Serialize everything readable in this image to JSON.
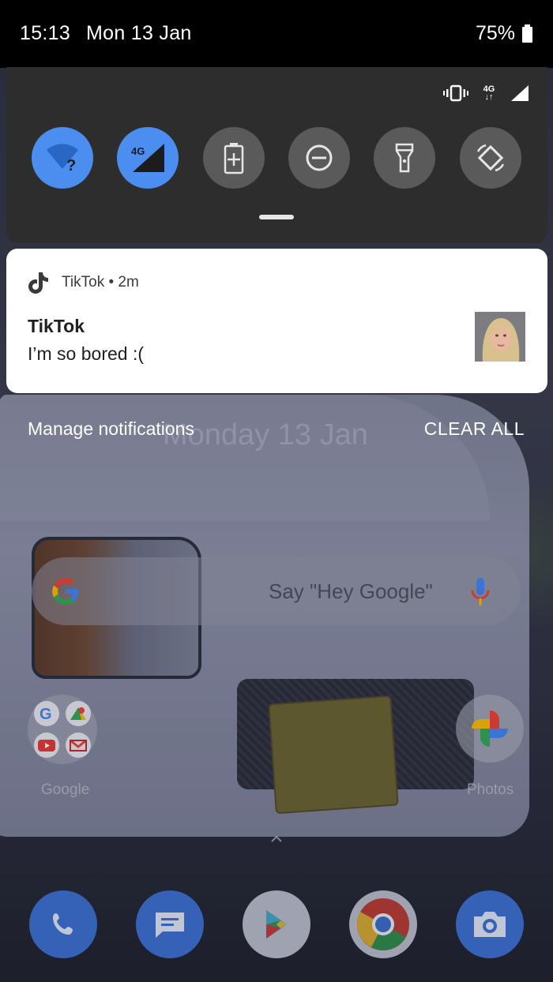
{
  "status_bar": {
    "time": "15:13",
    "date": "Mon 13 Jan",
    "battery": "75%"
  },
  "quick_settings": {
    "network_label": "4G",
    "tiles": [
      {
        "icon": "wifi-unknown-icon",
        "active": true
      },
      {
        "icon": "mobile-data-4g-icon",
        "active": true,
        "label": "4G"
      },
      {
        "icon": "battery-saver-icon",
        "active": false
      },
      {
        "icon": "do-not-disturb-icon",
        "active": false
      },
      {
        "icon": "flashlight-icon",
        "active": false
      },
      {
        "icon": "auto-rotate-icon",
        "active": false
      }
    ]
  },
  "notification": {
    "app": "TikTok",
    "separator": "•",
    "age": "2m",
    "title": "TikTok",
    "text": "I’m so bored :("
  },
  "shade_actions": {
    "manage": "Manage notifications",
    "clear_all": "CLEAR ALL"
  },
  "lockscreen": {
    "date": "Monday 13 Jan"
  },
  "search": {
    "placeholder": "Say \"Hey Google\""
  },
  "apps": {
    "folder_label": "Google",
    "photos_label": "Photos"
  },
  "dock": [
    "phone-icon",
    "messages-icon",
    "play-store-icon",
    "chrome-icon",
    "camera-icon"
  ],
  "colors": {
    "accent_blue": "#4c8ef0",
    "qs_background": "#2d2d2d",
    "tile_inactive": "#5a5a5a"
  }
}
